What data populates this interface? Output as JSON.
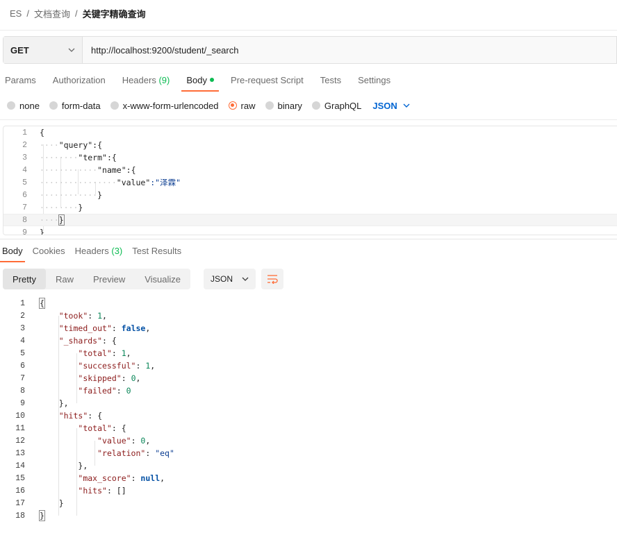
{
  "breadcrumb": {
    "items": [
      "ES",
      "文档查询",
      "关键字精确查询"
    ]
  },
  "request": {
    "method": "GET",
    "url": "http://localhost:9200/student/_search"
  },
  "request_tabs": [
    {
      "label": "Params",
      "count": ""
    },
    {
      "label": "Authorization",
      "count": ""
    },
    {
      "label": "Headers",
      "count": "(9)"
    },
    {
      "label": "Body",
      "count": ""
    },
    {
      "label": "Pre-request Script",
      "count": ""
    },
    {
      "label": "Tests",
      "count": ""
    },
    {
      "label": "Settings",
      "count": ""
    }
  ],
  "body_types": {
    "options": [
      "none",
      "form-data",
      "x-www-form-urlencoded",
      "raw",
      "binary",
      "GraphQL"
    ],
    "selected": "raw",
    "format": "JSON"
  },
  "request_body": {
    "line_numbers": [
      "1",
      "2",
      "3",
      "4",
      "5",
      "6",
      "7",
      "8",
      "9"
    ],
    "lines": [
      {
        "indent": "",
        "key": "",
        "rest": "{"
      },
      {
        "indent": "····",
        "key": "\"query\"",
        "rest": ":{"
      },
      {
        "indent": "········",
        "key": "\"term\"",
        "rest": ":{"
      },
      {
        "indent": "············",
        "key": "\"name\"",
        "rest": ":{"
      },
      {
        "indent": "················",
        "key": "\"value\"",
        "rest": ":\"泽霖\""
      },
      {
        "indent": "············",
        "key": "",
        "rest": "}"
      },
      {
        "indent": "········",
        "key": "",
        "rest": "}"
      },
      {
        "indent": "····",
        "key": "",
        "rest": "}"
      },
      {
        "indent": "",
        "key": "",
        "rest": "}"
      }
    ]
  },
  "response_tabs": [
    {
      "label": "Body",
      "count": ""
    },
    {
      "label": "Cookies",
      "count": ""
    },
    {
      "label": "Headers",
      "count": "(3)"
    },
    {
      "label": "Test Results",
      "count": ""
    }
  ],
  "response_views": [
    "Pretty",
    "Raw",
    "Preview",
    "Visualize"
  ],
  "response_format": "JSON",
  "response_body": {
    "line_numbers": [
      "1",
      "2",
      "3",
      "4",
      "5",
      "6",
      "7",
      "8",
      "9",
      "10",
      "11",
      "12",
      "13",
      "14",
      "15",
      "16",
      "17",
      "18"
    ],
    "lines": [
      {
        "indent": "",
        "key": "",
        "sep": "",
        "value": "",
        "vtype": "p",
        "tail": "{"
      },
      {
        "indent": "    ",
        "key": "\"took\"",
        "sep": ": ",
        "value": "1",
        "vtype": "n",
        "tail": ","
      },
      {
        "indent": "    ",
        "key": "\"timed_out\"",
        "sep": ": ",
        "value": "false",
        "vtype": "b",
        "tail": ","
      },
      {
        "indent": "    ",
        "key": "\"_shards\"",
        "sep": ": ",
        "value": "",
        "vtype": "p",
        "tail": "{"
      },
      {
        "indent": "        ",
        "key": "\"total\"",
        "sep": ": ",
        "value": "1",
        "vtype": "n",
        "tail": ","
      },
      {
        "indent": "        ",
        "key": "\"successful\"",
        "sep": ": ",
        "value": "1",
        "vtype": "n",
        "tail": ","
      },
      {
        "indent": "        ",
        "key": "\"skipped\"",
        "sep": ": ",
        "value": "0",
        "vtype": "n",
        "tail": ","
      },
      {
        "indent": "        ",
        "key": "\"failed\"",
        "sep": ": ",
        "value": "0",
        "vtype": "n",
        "tail": ""
      },
      {
        "indent": "    ",
        "key": "",
        "sep": "",
        "value": "",
        "vtype": "p",
        "tail": "},"
      },
      {
        "indent": "    ",
        "key": "\"hits\"",
        "sep": ": ",
        "value": "",
        "vtype": "p",
        "tail": "{"
      },
      {
        "indent": "        ",
        "key": "\"total\"",
        "sep": ": ",
        "value": "",
        "vtype": "p",
        "tail": "{"
      },
      {
        "indent": "            ",
        "key": "\"value\"",
        "sep": ": ",
        "value": "0",
        "vtype": "n",
        "tail": ","
      },
      {
        "indent": "            ",
        "key": "\"relation\"",
        "sep": ": ",
        "value": "\"eq\"",
        "vtype": "s",
        "tail": ""
      },
      {
        "indent": "        ",
        "key": "",
        "sep": "",
        "value": "",
        "vtype": "p",
        "tail": "},"
      },
      {
        "indent": "        ",
        "key": "\"max_score\"",
        "sep": ": ",
        "value": "null",
        "vtype": "b",
        "tail": ","
      },
      {
        "indent": "        ",
        "key": "\"hits\"",
        "sep": ": ",
        "value": "",
        "vtype": "p",
        "tail": "[]"
      },
      {
        "indent": "    ",
        "key": "",
        "sep": "",
        "value": "",
        "vtype": "p",
        "tail": "}"
      },
      {
        "indent": "",
        "key": "",
        "sep": "",
        "value": "",
        "vtype": "p",
        "tail": "}"
      }
    ]
  },
  "colors": {
    "accent": "#ff6c37",
    "link": "#0265d2",
    "count": "#0cbb52"
  },
  "icons": {
    "method_dropdown": "chevron-down-icon",
    "format_dropdown": "chevron-down-icon",
    "wrap": "wrap-lines-icon"
  }
}
